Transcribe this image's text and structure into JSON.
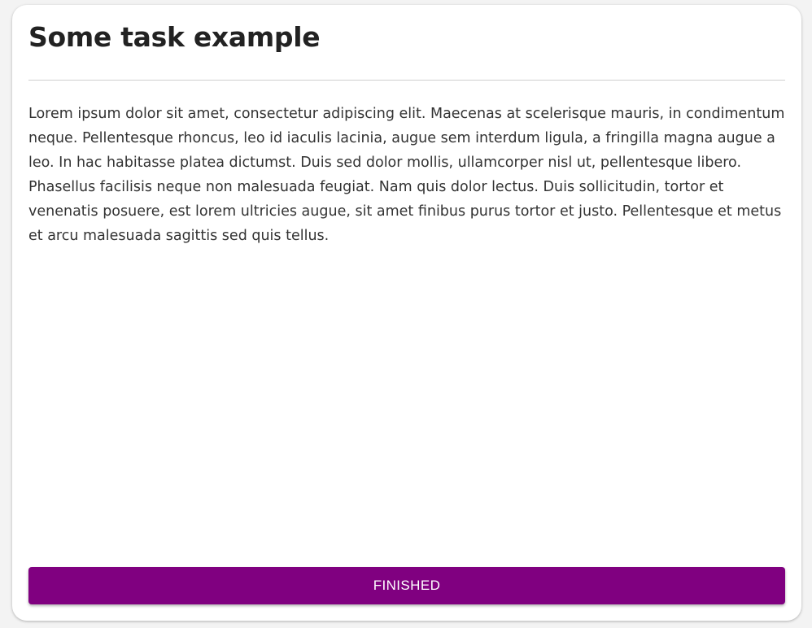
{
  "card": {
    "title": "Some task example",
    "description": "Lorem ipsum dolor sit amet, consectetur adipiscing elit. Maecenas at scelerisque mauris, in condimentum neque. Pellentesque rhoncus, leo id iaculis lacinia, augue sem interdum ligula, a fringilla magna augue a leo. In hac habitasse platea dictumst. Duis sed dolor mollis, ullamcorper nisl ut, pellentesque libero. Phasellus facilisis neque non malesuada feugiat. Nam quis dolor lectus. Duis sollicitudin, tortor et venenatis posuere, est lorem ultricies augue, sit amet finibus purus tortor et justo. Pellentesque et metus et arcu malesuada sagittis sed quis tellus.",
    "button_label": "FINISHED"
  },
  "colors": {
    "accent": "#800080",
    "background": "#f3f3f3",
    "card": "#ffffff"
  }
}
